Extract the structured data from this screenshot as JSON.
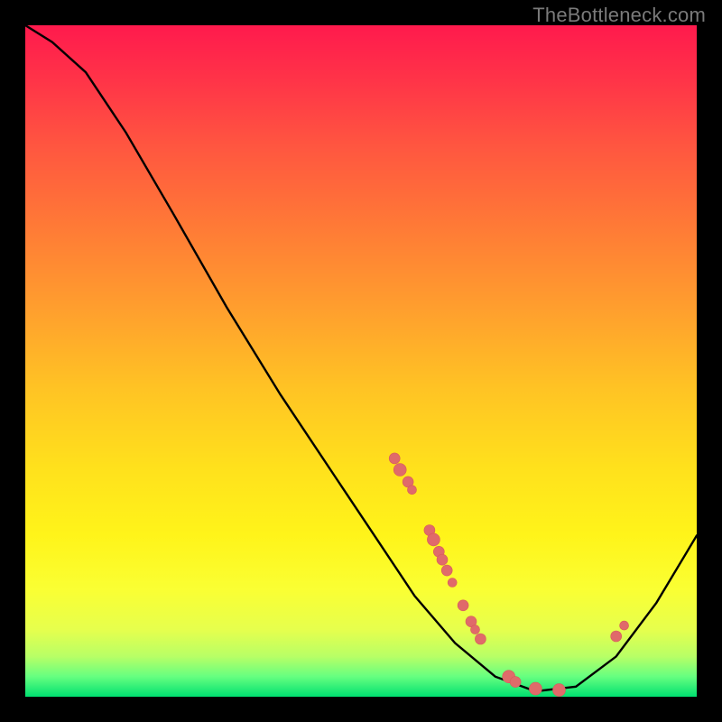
{
  "watermark": "TheBottleneck.com",
  "colors": {
    "curve_stroke": "#000000",
    "dot_fill": "#e06a6a",
    "dot_stroke": "#d85a5a"
  },
  "chart_data": {
    "type": "line",
    "title": "",
    "xlabel": "",
    "ylabel": "",
    "xlim": [
      0,
      100
    ],
    "ylim": [
      0,
      100
    ],
    "curve_points": [
      {
        "x": 0.0,
        "y": 100.0
      },
      {
        "x": 4.0,
        "y": 97.5
      },
      {
        "x": 9.0,
        "y": 93.0
      },
      {
        "x": 15.0,
        "y": 84.0
      },
      {
        "x": 22.0,
        "y": 72.0
      },
      {
        "x": 30.0,
        "y": 58.0
      },
      {
        "x": 38.0,
        "y": 45.0
      },
      {
        "x": 46.0,
        "y": 33.0
      },
      {
        "x": 52.0,
        "y": 24.0
      },
      {
        "x": 58.0,
        "y": 15.0
      },
      {
        "x": 64.0,
        "y": 8.0
      },
      {
        "x": 70.0,
        "y": 3.0
      },
      {
        "x": 76.0,
        "y": 0.8
      },
      {
        "x": 82.0,
        "y": 1.5
      },
      {
        "x": 88.0,
        "y": 6.0
      },
      {
        "x": 94.0,
        "y": 14.0
      },
      {
        "x": 100.0,
        "y": 24.0
      }
    ],
    "scatter": [
      {
        "x": 55.0,
        "y": 35.5,
        "r": 6
      },
      {
        "x": 55.8,
        "y": 33.8,
        "r": 7
      },
      {
        "x": 57.0,
        "y": 32.0,
        "r": 6
      },
      {
        "x": 57.6,
        "y": 30.8,
        "r": 5
      },
      {
        "x": 60.2,
        "y": 24.8,
        "r": 6
      },
      {
        "x": 60.8,
        "y": 23.4,
        "r": 7
      },
      {
        "x": 61.6,
        "y": 21.6,
        "r": 6
      },
      {
        "x": 62.1,
        "y": 20.4,
        "r": 6
      },
      {
        "x": 62.8,
        "y": 18.8,
        "r": 6
      },
      {
        "x": 63.6,
        "y": 17.0,
        "r": 5
      },
      {
        "x": 65.2,
        "y": 13.6,
        "r": 6
      },
      {
        "x": 66.4,
        "y": 11.2,
        "r": 6
      },
      {
        "x": 67.0,
        "y": 10.0,
        "r": 5
      },
      {
        "x": 67.8,
        "y": 8.6,
        "r": 6
      },
      {
        "x": 72.0,
        "y": 3.0,
        "r": 7
      },
      {
        "x": 73.0,
        "y": 2.2,
        "r": 6
      },
      {
        "x": 76.0,
        "y": 1.2,
        "r": 7
      },
      {
        "x": 79.5,
        "y": 1.0,
        "r": 7
      },
      {
        "x": 88.0,
        "y": 9.0,
        "r": 6
      },
      {
        "x": 89.2,
        "y": 10.6,
        "r": 5
      }
    ]
  }
}
